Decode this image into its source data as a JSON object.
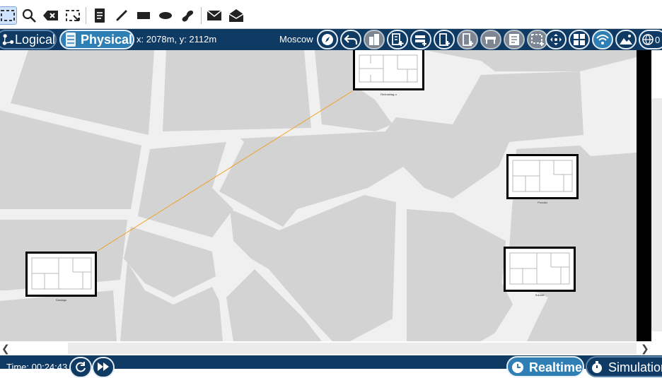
{
  "toolbar": {
    "tools": [
      {
        "name": "select",
        "icon": "select-rect-icon",
        "selected": true
      },
      {
        "name": "zoom",
        "icon": "magnifier-icon"
      },
      {
        "name": "delete",
        "icon": "delete-backspace-icon"
      },
      {
        "name": "resize",
        "icon": "resize-rect-icon"
      },
      {
        "name": "note",
        "icon": "note-icon"
      },
      {
        "name": "line",
        "icon": "line-icon"
      },
      {
        "name": "rectangle",
        "icon": "rectangle-icon"
      },
      {
        "name": "ellipse",
        "icon": "ellipse-icon"
      },
      {
        "name": "freeform",
        "icon": "freeform-icon"
      },
      {
        "name": "add-simple-pdu",
        "icon": "closed-envelope-icon"
      },
      {
        "name": "add-complex-pdu",
        "icon": "open-envelope-icon"
      }
    ]
  },
  "nav": {
    "logical_label": "Logical",
    "physical_label": "Physical",
    "coords": "x: 2078m, y: 2112m",
    "location": "Moscow",
    "overflow_text": "0"
  },
  "map": {
    "buildings": [
      {
        "name": "Rednaklag-u",
        "id": "building-top"
      },
      {
        "name": "Procato",
        "id": "building-right-upper"
      },
      {
        "name": "Sdonet",
        "id": "building-right-lower"
      },
      {
        "name": "Dordago",
        "id": "building-left"
      }
    ],
    "link_color": "#f0a020"
  },
  "bottom": {
    "time_text": "Time: 00:24:43",
    "realtime_label": "Realtime",
    "simulation_label": "Simulation"
  },
  "colors": {
    "navbar": "#0f3a63",
    "active_button": "#2f7fb5",
    "map_block": "#d3d3d3",
    "map_road": "#f0f0f0"
  }
}
